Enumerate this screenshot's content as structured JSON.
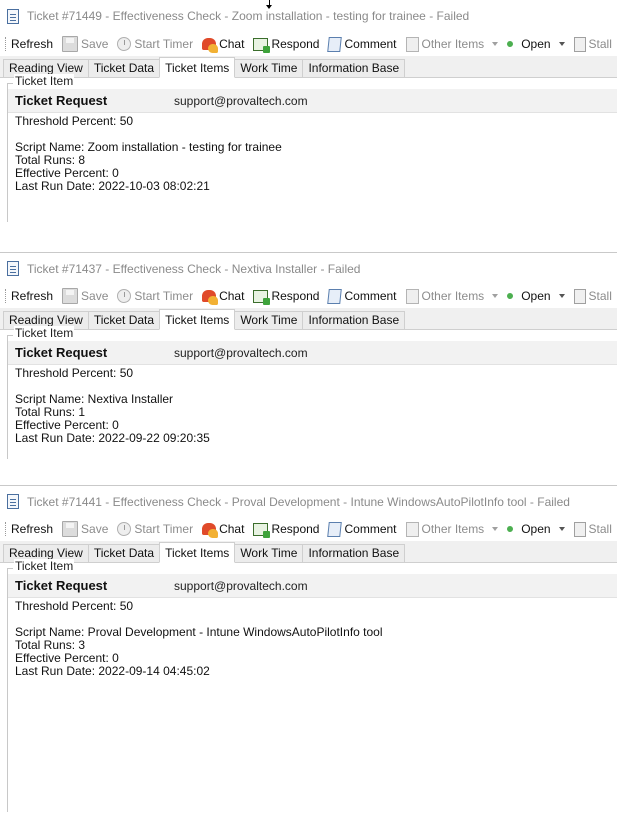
{
  "toolbar": {
    "refresh": "Refresh",
    "save": "Save",
    "start_timer": "Start Timer",
    "chat": "Chat",
    "respond": "Respond",
    "comment": "Comment",
    "other_items": "Other Items",
    "open": "Open",
    "stall": "Stall"
  },
  "tabs": [
    "Reading View",
    "Ticket Data",
    "Ticket Items",
    "Work Time",
    "Information Base"
  ],
  "active_tab": "Ticket Items",
  "group_label": "Ticket Item",
  "ticket_request_label": "Ticket Request",
  "windows": [
    {
      "title": "Ticket #71449 - Effectiveness Check - Zoom installation - testing for trainee - Failed",
      "email": "support@provaltech.com",
      "threshold": "Threshold Percent: 50",
      "script_name": "Script Name: Zoom installation - testing for trainee",
      "total_runs": "Total Runs: 8",
      "effective_percent": "Effective Percent: 0",
      "last_run_date": "Last Run Date: 2022-10-03 08:02:21"
    },
    {
      "title": "Ticket #71437 - Effectiveness Check - Nextiva Installer - Failed",
      "email": "support@provaltech.com",
      "threshold": "Threshold Percent: 50",
      "script_name": "Script Name: Nextiva Installer",
      "total_runs": "Total Runs: 1",
      "effective_percent": "Effective Percent: 0",
      "last_run_date": "Last Run Date: 2022-09-22 09:20:35"
    },
    {
      "title": "Ticket #71441 - Effectiveness Check - Proval Development - Intune WindowsAutoPilotInfo tool - Failed",
      "email": "support@provaltech.com",
      "threshold": "Threshold Percent: 50",
      "script_name": "Script Name: Proval Development - Intune WindowsAutoPilotInfo tool",
      "total_runs": "Total Runs: 3",
      "effective_percent": "Effective Percent: 0",
      "last_run_date": "Last Run Date: 2022-09-14 04:45:02"
    }
  ]
}
